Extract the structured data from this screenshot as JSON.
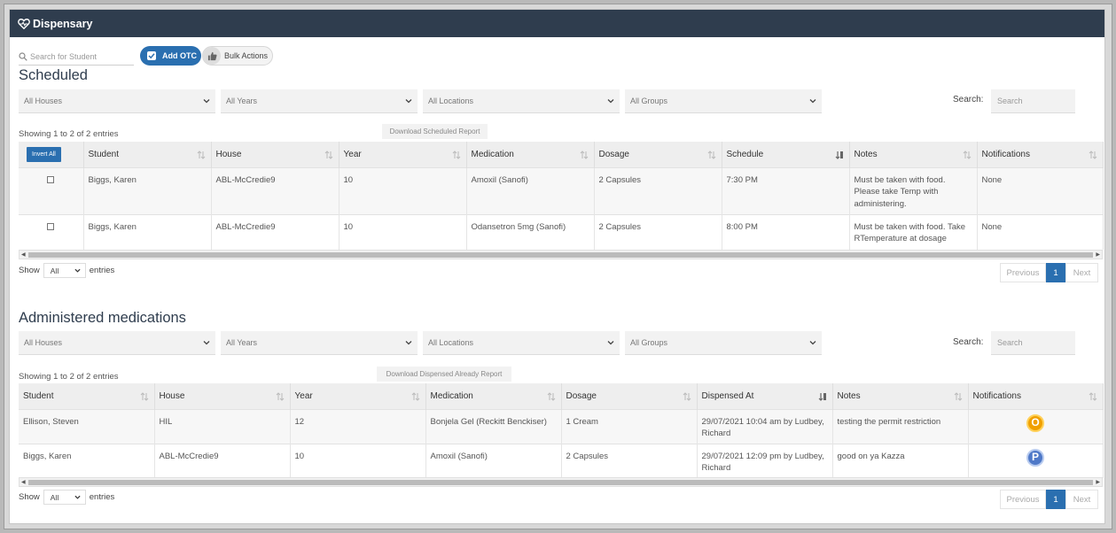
{
  "app": {
    "title": "Dispensary"
  },
  "toolbar": {
    "search_placeholder": "Search for Student",
    "add_otc_label": "Add OTC",
    "bulk_actions_label": "Bulk Actions"
  },
  "scheduled": {
    "heading": "Scheduled",
    "filters": [
      "All Houses",
      "All Years",
      "All Locations",
      "All Groups"
    ],
    "search_label": "Search:",
    "search_placeholder": "Search",
    "showing": "Showing 1 to 2 of 2 entries",
    "download_label": "Download Scheduled Report",
    "invert_label": "Invert All",
    "columns": [
      "Student",
      "House",
      "Year",
      "Medication",
      "Dosage",
      "Schedule",
      "Notes",
      "Notifications"
    ],
    "rows": [
      {
        "student": "Biggs, Karen",
        "house": "ABL-McCredie9",
        "year": "10",
        "medication": "Amoxil (Sanofi)",
        "dosage": "2 Capsules",
        "schedule": "7:30 PM",
        "notes": "Must be taken with food. Please take Temp with administering.",
        "notifications": "None"
      },
      {
        "student": "Biggs, Karen",
        "house": "ABL-McCredie9",
        "year": "10",
        "medication": "Odansetron 5mg (Sanofi)",
        "dosage": "2 Capsules",
        "schedule": "8:00 PM",
        "notes": "Must be taken with food. Take RTemperature at dosage",
        "notifications": "None"
      }
    ],
    "show_label": "Show",
    "show_value": "All",
    "entries_label": "entries",
    "pager": {
      "previous": "Previous",
      "page": "1",
      "next": "Next"
    }
  },
  "administered": {
    "heading": "Administered medications",
    "filters": [
      "All Houses",
      "All Years",
      "All Locations",
      "All Groups"
    ],
    "search_label": "Search:",
    "search_placeholder": "Search",
    "showing": "Showing 1 to 2 of 2 entries",
    "download_label": "Download Dispensed Already Report",
    "columns": [
      "Student",
      "House",
      "Year",
      "Medication",
      "Dosage",
      "Dispensed At",
      "Notes",
      "Notifications"
    ],
    "rows": [
      {
        "student": "Ellison, Steven",
        "house": "HIL",
        "year": "12",
        "medication": "Bonjela Gel (Reckitt Benckiser)",
        "dosage": "1 Cream",
        "dispensed_at": "29/07/2021 10:04 am by Ludbey, Richard",
        "notes": "testing the permit restriction",
        "badge": "O",
        "badge_color": "#f0a000"
      },
      {
        "student": "Biggs, Karen",
        "house": "ABL-McCredie9",
        "year": "10",
        "medication": "Amoxil (Sanofi)",
        "dosage": "2 Capsules",
        "dispensed_at": "29/07/2021 12:09 pm by Ludbey, Richard",
        "notes": "good on ya Kazza",
        "badge": "P",
        "badge_color": "#4f79c8"
      }
    ],
    "show_label": "Show",
    "show_value": "All",
    "entries_label": "entries",
    "pager": {
      "previous": "Previous",
      "page": "1",
      "next": "Next"
    }
  },
  "colors": {
    "header_bg": "#2f3d4e",
    "accent": "#2a6fb0"
  }
}
